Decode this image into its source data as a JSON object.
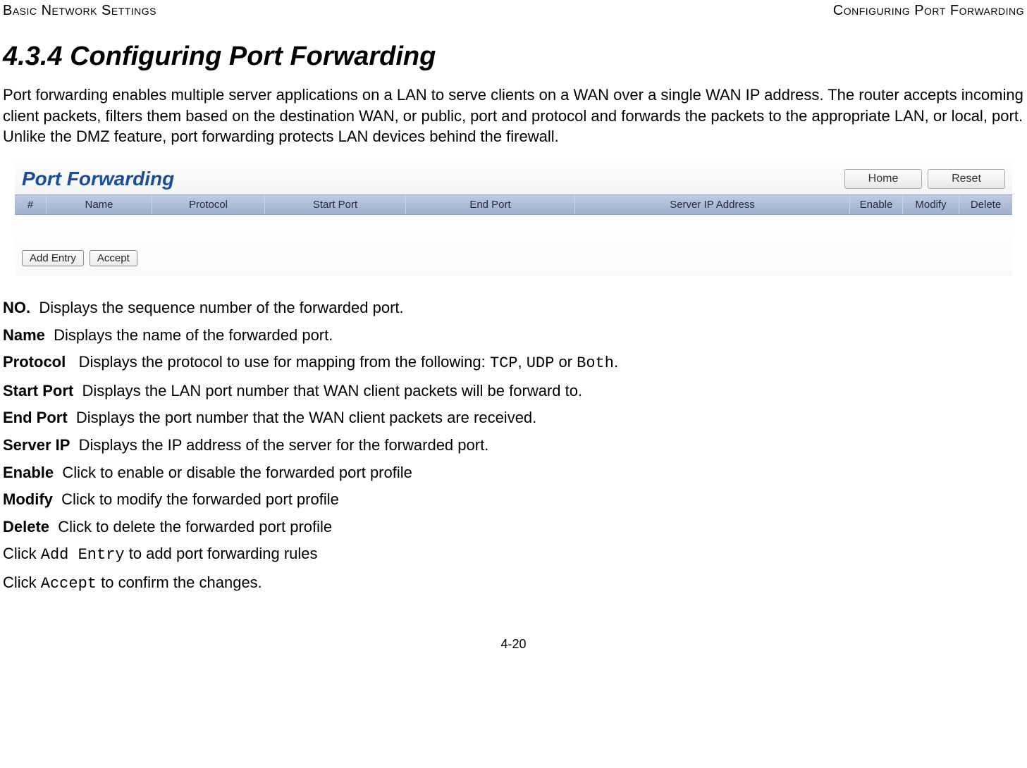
{
  "running": {
    "left": "Basic Network Settings",
    "right": "Configuring Port Forwarding"
  },
  "heading": "4.3.4 Configuring Port Forwarding",
  "intro": "Port forwarding enables multiple server applications on a LAN to serve clients on a WAN over a single WAN IP address. The router accepts incoming client packets, filters them based on the destination WAN, or public, port and protocol and forwards the packets to the appropriate LAN, or local, port. Unlike the DMZ feature, port forwarding protects LAN devices behind the firewall.",
  "ui": {
    "title": "Port Forwarding",
    "home_btn": "Home",
    "reset_btn": "Reset",
    "columns": {
      "num": "#",
      "name": "Name",
      "protocol": "Protocol",
      "start_port": "Start Port",
      "end_port": "End Port",
      "server_ip": "Server IP Address",
      "enable": "Enable",
      "modify": "Modify",
      "delete": "Delete"
    },
    "add_entry_btn": "Add Entry",
    "accept_btn": "Accept"
  },
  "definitions": [
    {
      "term": "NO.",
      "desc": "Displays the sequence number of the forwarded port."
    },
    {
      "term": "Name",
      "desc": "Displays the name of the forwarded port."
    },
    {
      "term": "Protocol",
      "desc_pre": "Displays the protocol to use for mapping from the following: ",
      "mono1": "TCP",
      "sep1": ", ",
      "mono2": "UDP",
      "sep2": " or ",
      "mono3": "Both",
      "desc_post": "."
    },
    {
      "term": "Start Port",
      "desc": "Displays the LAN port number that WAN client packets will be forward to."
    },
    {
      "term": "End Port",
      "desc": "Displays the port number that the WAN client packets are received."
    },
    {
      "term": "Server IP",
      "desc": "Displays the IP address of the server for the forwarded port."
    },
    {
      "term": "Enable",
      "desc": "Click to enable or disable the forwarded port profile"
    },
    {
      "term": "Modify",
      "desc": "Click to modify the forwarded port profile"
    },
    {
      "term": "Delete",
      "desc": "Click to delete the forwarded port profile"
    }
  ],
  "notes": {
    "add_pre": "Click ",
    "add_mono": "Add Entry",
    "add_post": " to add port forwarding rules",
    "accept_pre": "Click ",
    "accept_mono": "Accept",
    "accept_post": " to confirm the changes."
  },
  "page_number": "4-20"
}
